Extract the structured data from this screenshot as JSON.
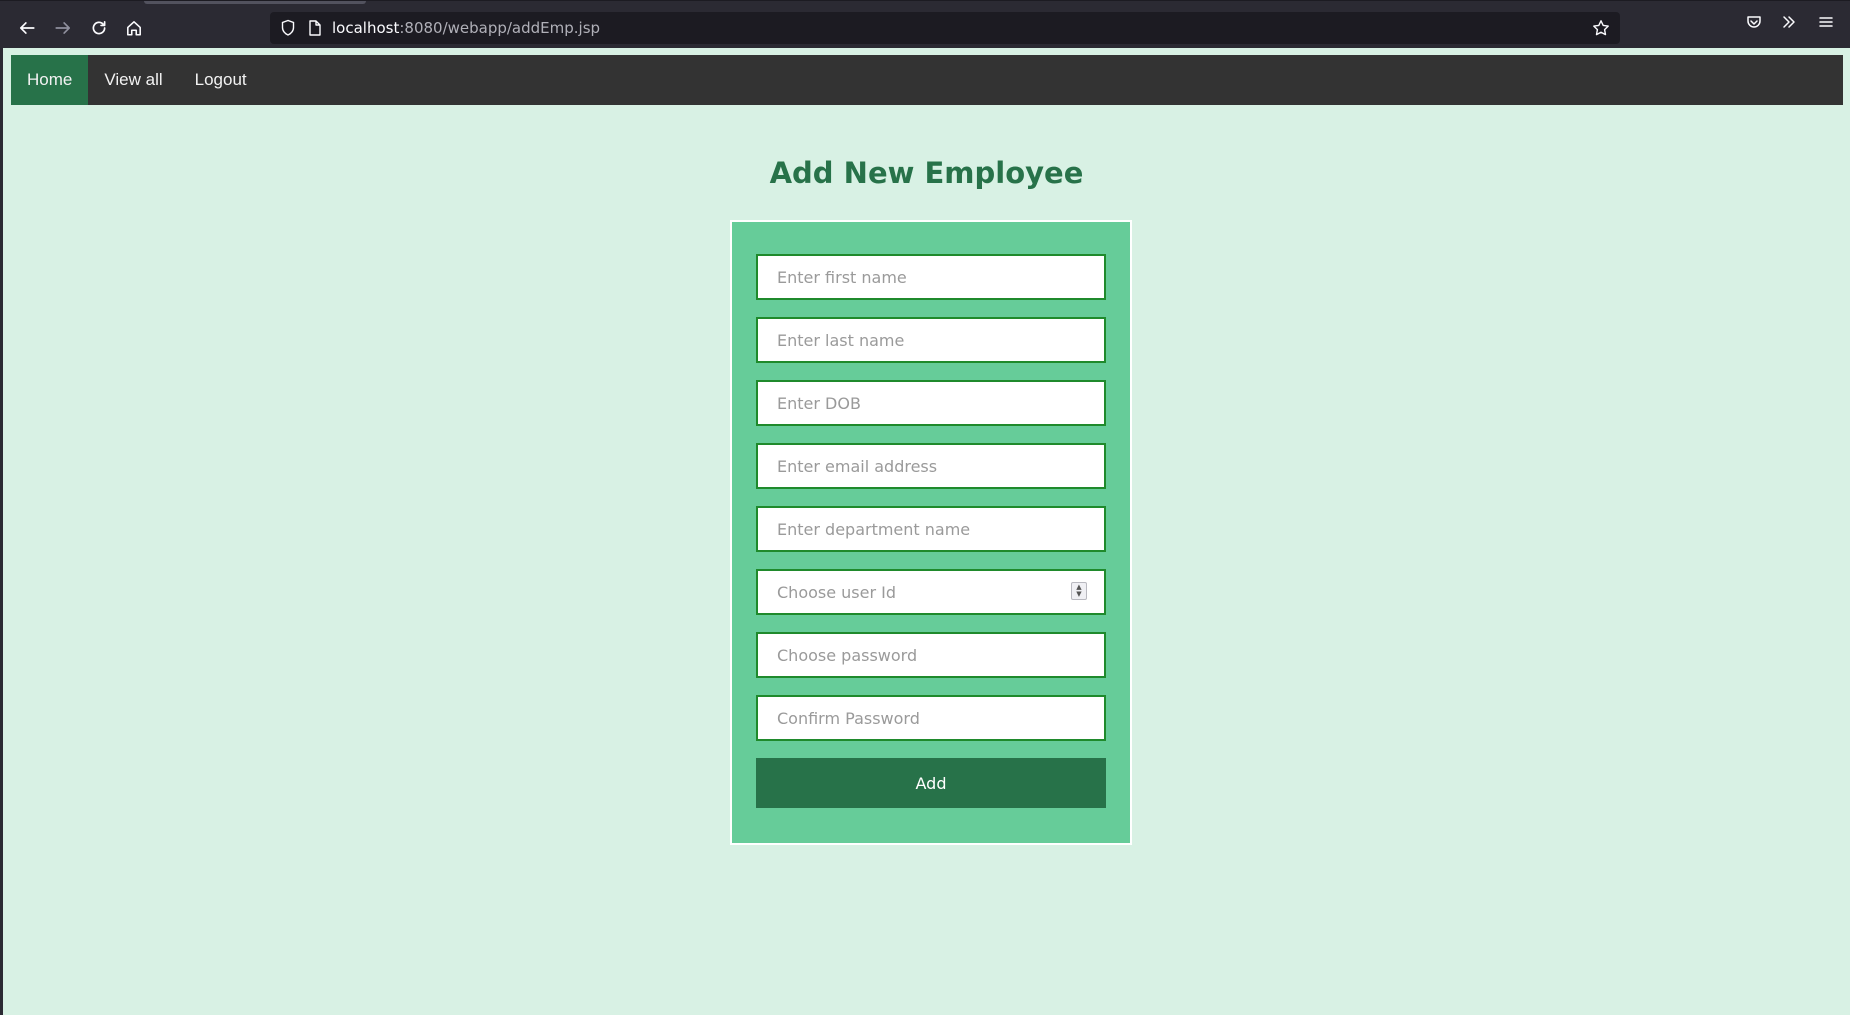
{
  "browser": {
    "url_host": "localhost",
    "url_rest": ":8080/webapp/addEmp.jsp"
  },
  "nav": {
    "items": [
      {
        "label": "Home",
        "active": true
      },
      {
        "label": "View all",
        "active": false
      },
      {
        "label": "Logout",
        "active": false
      }
    ]
  },
  "page": {
    "title": "Add New Employee"
  },
  "form": {
    "first_name_placeholder": "Enter first name",
    "last_name_placeholder": "Enter last name",
    "dob_placeholder": "Enter DOB",
    "email_placeholder": "Enter email address",
    "department_placeholder": "Enter department name",
    "user_id_placeholder": "Choose user Id",
    "password_placeholder": "Choose password",
    "confirm_password_placeholder": "Confirm Password",
    "submit_label": "Add"
  },
  "colors": {
    "page_background": "#d8f1e4",
    "navbar": "#333333",
    "accent": "#277249",
    "card": "#66cc99",
    "field_border": "#1f8a2c"
  }
}
